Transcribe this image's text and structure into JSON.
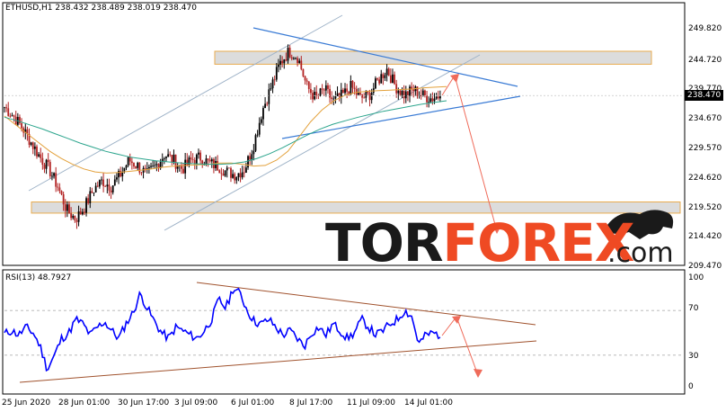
{
  "chart_data": [
    {
      "type": "candlestick",
      "symbol_label": "ETHUSD,H1",
      "ohlc_readout": [
        "238.432",
        "238.489",
        "238.019",
        "238.470"
      ],
      "last_price": "238.470",
      "y_ticks": [
        "249.820",
        "244.720",
        "239.770",
        "234.670",
        "229.570",
        "224.620",
        "219.520",
        "214.420",
        "209.470"
      ],
      "x_ticks": [
        "25 Jun 2020",
        "28 Jun 01:00",
        "30 Jun 17:00",
        "3 Jul 09:00",
        "6 Jul 01:00",
        "8 Jul 17:00",
        "11 Jul 09:00",
        "14 Jul 01:00"
      ],
      "ylim": [
        209.47,
        249.82
      ],
      "close_path": [
        236.5,
        235.0,
        233.0,
        230.5,
        228.0,
        226.0,
        223.0,
        219.0,
        217.5,
        219.5,
        222.5,
        224.0,
        223.0,
        225.0,
        227.5,
        226.5,
        225.0,
        226.5,
        228.5,
        227.5,
        226.0,
        227.5,
        228.0,
        227.0,
        226.5,
        225.5,
        225.0,
        226.0,
        230.0,
        236.0,
        240.0,
        244.0,
        246.0,
        245.0,
        240.0,
        238.0,
        239.5,
        237.5,
        238.5,
        240.0,
        238.0,
        238.5,
        241.0,
        243.0,
        240.0,
        238.5,
        239.5,
        238.5,
        238.0,
        238.47
      ],
      "moving_averages": [
        {
          "color": "#e3a13b",
          "values": [
            235.0,
            233.5,
            232.0,
            230.5,
            229.0,
            227.8,
            226.8,
            226.0,
            225.5,
            225.3,
            225.4,
            225.6,
            225.8,
            226.0,
            226.3,
            226.5,
            226.6,
            226.7,
            226.8,
            227.0,
            227.0,
            226.8,
            226.5,
            226.6,
            227.5,
            229.0,
            231.5,
            234.0,
            236.0,
            237.5,
            238.5,
            239.0,
            239.2,
            239.3,
            239.4,
            239.5,
            239.6,
            239.8,
            239.9,
            240.0
          ]
        },
        {
          "color": "#2ca58d",
          "values": [
            234.8,
            234.2,
            233.5,
            232.8,
            232.0,
            231.2,
            230.4,
            229.7,
            229.0,
            228.5,
            228.0,
            227.7,
            227.4,
            227.2,
            227.0,
            226.9,
            226.8,
            226.8,
            226.9,
            227.2,
            227.8,
            228.6,
            229.6,
            230.7,
            231.8,
            232.8,
            233.6,
            234.2,
            234.8,
            235.3,
            235.8,
            236.2,
            236.6,
            237.0,
            237.3,
            237.6
          ]
        }
      ],
      "zones": [
        {
          "from": 243.8,
          "to": 246.0
        },
        {
          "from": 218.5,
          "to": 220.4
        }
      ],
      "watermark": {
        "left": "TOR",
        "right": "FOREX",
        "suffix": ".com",
        "colors": [
          "#1a1a1a",
          "#ef4a23"
        ]
      },
      "grid": false
    },
    {
      "type": "line",
      "indicator_label": "RSI(13) 48.7927",
      "ylim": [
        0,
        100
      ],
      "y_ticks": [
        "100",
        "70",
        "30",
        "0"
      ],
      "line_color": "#0000ff",
      "values": [
        49,
        52,
        48,
        55,
        50,
        38,
        17,
        30,
        45,
        50,
        62,
        58,
        48,
        55,
        60,
        52,
        45,
        58,
        68,
        85,
        72,
        60,
        50,
        45,
        55,
        52,
        48,
        45,
        52,
        62,
        80,
        72,
        90,
        85,
        70,
        60,
        58,
        62,
        55,
        48,
        52,
        45,
        38,
        50,
        55,
        48,
        58,
        52,
        45,
        50,
        62,
        55,
        48,
        52,
        58,
        62,
        70,
        65,
        40,
        48,
        50,
        48
      ]
    }
  ]
}
